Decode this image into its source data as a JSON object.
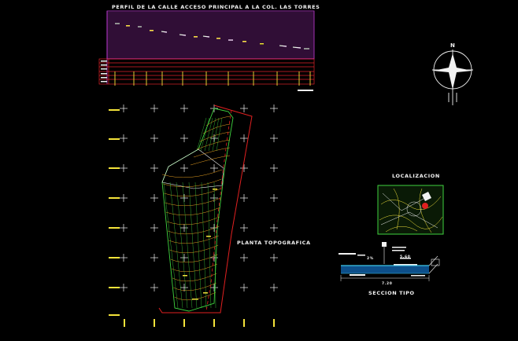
{
  "profile": {
    "title": "PERFIL DE LA CALLE ACCESO PRINCIPAL A LA COL. LAS TORRES"
  },
  "plan": {
    "title": "PLANTA TOPOGRAFICA"
  },
  "location": {
    "title": "LOCALIZACION"
  },
  "section": {
    "title": "SECCION TIPO",
    "total_width": "7.20",
    "lane_width": "5.60",
    "lane_pct": "2%"
  },
  "north": {
    "letter": "N"
  },
  "colors": {
    "profile_grid": "#c23bd9",
    "profile_table": "#e0222a",
    "terrain_green": "#3fd23f",
    "contour_orange": "#e8a020",
    "frame_red": "#e02020",
    "yellow": "#f4e33a",
    "cyan": "#3fc6e8",
    "white": "#f2f2f2"
  }
}
